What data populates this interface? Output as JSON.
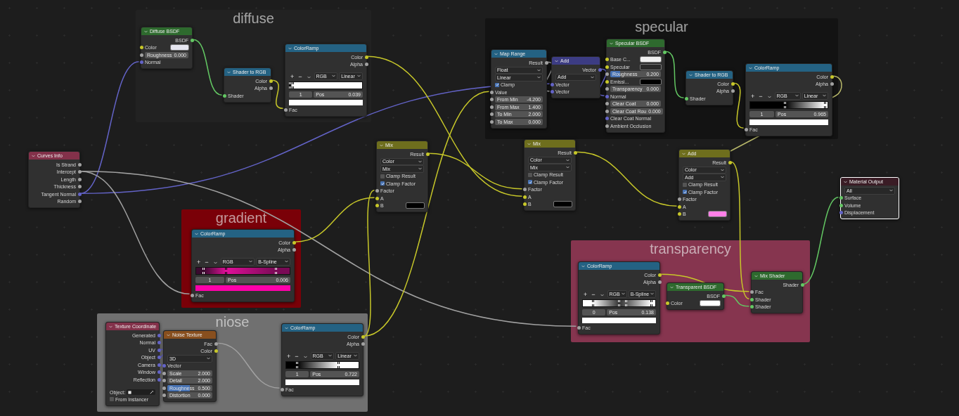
{
  "frames": [
    {
      "label": "diffuse",
      "color": "#222222"
    },
    {
      "label": "specular",
      "color": "#131313"
    },
    {
      "label": "gradient",
      "color": "#7a0008"
    },
    {
      "label": "niose",
      "color": "#707070"
    },
    {
      "label": "transparency",
      "color": "#86354f"
    }
  ],
  "nodes": [
    {
      "title": "Curves Info",
      "color": "#83314a",
      "selected": false,
      "rows": [
        {
          "kind": "output",
          "label": "Is Strand",
          "socket": {
            "color": "#a1a1a1"
          }
        },
        {
          "kind": "output",
          "label": "Intercept",
          "socket": {
            "color": "#a1a1a1"
          }
        },
        {
          "kind": "output",
          "label": "Length",
          "socket": {
            "color": "#a1a1a1"
          }
        },
        {
          "kind": "output",
          "label": "Thickness",
          "socket": {
            "color": "#a1a1a1"
          }
        },
        {
          "kind": "output",
          "label": "Tangent Normal",
          "socket": {
            "color": "#6363c7"
          }
        },
        {
          "kind": "output",
          "label": "Random",
          "socket": {
            "color": "#a1a1a1"
          }
        }
      ]
    },
    {
      "title": "Diffuse BSDF",
      "color": "#2e6a2e",
      "selected": false,
      "rows": [
        {
          "kind": "output",
          "label": "BSDF",
          "socket": {
            "color": "#63c763"
          }
        },
        {
          "kind": "swatch",
          "label": "Color",
          "socket": {
            "color": "#c7c729"
          },
          "color": "#e6e6f0"
        },
        {
          "kind": "value",
          "label": "Roughness",
          "value": "0.000",
          "socket": {
            "color": "#a1a1a1"
          }
        },
        {
          "kind": "input",
          "label": "Normal",
          "socket": {
            "color": "#6363c7"
          }
        }
      ]
    },
    {
      "title": "Shader to RGB",
      "color": "#246283",
      "selected": false,
      "rows": [
        {
          "kind": "output",
          "label": "Color",
          "socket": {
            "color": "#c7c729"
          }
        },
        {
          "kind": "output",
          "label": "Alpha",
          "socket": {
            "color": "#a1a1a1"
          }
        },
        {
          "kind": "input",
          "label": "Shader",
          "socket": {
            "color": "#63c763"
          }
        }
      ]
    },
    {
      "title": "ColorRamp",
      "color": "#246283",
      "selected": false,
      "rows": [
        {
          "kind": "output",
          "label": "Color",
          "socket": {
            "color": "#c7c729"
          }
        },
        {
          "kind": "output",
          "label": "Alpha",
          "socket": {
            "color": "#a1a1a1"
          }
        },
        {
          "kind": "ramp_tools",
          "add": "+",
          "remove": "−",
          "color_mode": "RGB",
          "interpolation": "Linear"
        },
        {
          "kind": "ramp",
          "stops": [
            {
              "color": "#000000",
              "level": 0.0
            },
            {
              "color": "#ffffff",
              "level": 0.039
            }
          ]
        },
        {
          "kind": "ramp_fields",
          "index": "1",
          "label": "Pos",
          "value": "0.039"
        },
        {
          "kind": "ramp_color",
          "color": "#ffffff"
        },
        {
          "kind": "input",
          "label": "Fac",
          "socket": {
            "color": "#a1a1a1"
          }
        }
      ]
    },
    {
      "title": "Map Range",
      "color": "#246283",
      "selected": false,
      "rows": [
        {
          "kind": "output",
          "label": "Result",
          "socket": {
            "color": "#a1a1a1"
          }
        },
        {
          "kind": "select",
          "value": "Float"
        },
        {
          "kind": "select",
          "value": "Linear"
        },
        {
          "kind": "check",
          "label": "Clamp",
          "checked": true
        },
        {
          "kind": "input",
          "label": "Value",
          "socket": {
            "color": "#a1a1a1"
          }
        },
        {
          "kind": "value",
          "label": "From Min",
          "value": "-4.200",
          "socket": {
            "color": "#a1a1a1"
          }
        },
        {
          "kind": "value",
          "label": "From Max",
          "value": "1.400",
          "socket": {
            "color": "#a1a1a1"
          }
        },
        {
          "kind": "value",
          "label": "To Min",
          "value": "2.000",
          "socket": {
            "color": "#a1a1a1"
          }
        },
        {
          "kind": "value",
          "label": "To Max",
          "value": "0.000",
          "socket": {
            "color": "#a1a1a1"
          }
        }
      ]
    },
    {
      "title": "Add",
      "color": "#3c3c83",
      "selected": false,
      "rows": [
        {
          "kind": "output",
          "label": "Vector",
          "socket": {
            "color": "#6363c7"
          }
        },
        {
          "kind": "select",
          "value": "Add"
        },
        {
          "kind": "input",
          "label": "Vector",
          "socket": {
            "color": "#6363c7"
          }
        },
        {
          "kind": "input",
          "label": "Vector",
          "socket": {
            "color": "#6363c7"
          }
        }
      ]
    },
    {
      "title": "Specular BSDF",
      "color": "#2e6a2e",
      "selected": false,
      "rows": [
        {
          "kind": "output",
          "label": "BSDF",
          "socket": {
            "color": "#63c763"
          }
        },
        {
          "kind": "swatch",
          "label": "Base C...",
          "socket": {
            "color": "#c7c729"
          },
          "color": "#f0f0f0"
        },
        {
          "kind": "swatch",
          "label": "Specular",
          "socket": {
            "color": "#c7c729"
          },
          "color": "#2a2a2a"
        },
        {
          "kind": "value",
          "label": "Roughness",
          "value": "0.200",
          "level": 0.2,
          "socket": {
            "color": "#a1a1a1"
          }
        },
        {
          "kind": "swatch",
          "label": "Emissi...",
          "socket": {
            "color": "#c7c729"
          },
          "color": "#000000"
        },
        {
          "kind": "value",
          "label": "Transparency",
          "value": "0.000",
          "socket": {
            "color": "#a1a1a1"
          }
        },
        {
          "kind": "input",
          "label": "Normal",
          "socket": {
            "color": "#6363c7"
          }
        },
        {
          "kind": "value",
          "label": "Clear Coat",
          "value": "0.000",
          "socket": {
            "color": "#a1a1a1"
          }
        },
        {
          "kind": "value",
          "label": "Clear Coat Rou",
          "value": "0.000",
          "socket": {
            "color": "#a1a1a1"
          }
        },
        {
          "kind": "input",
          "label": "Clear Coat Normal",
          "socket": {
            "color": "#6363c7"
          }
        },
        {
          "kind": "input",
          "label": "Ambient Occlusion",
          "socket": {
            "color": "#a1a1a1"
          }
        }
      ]
    },
    {
      "title": "Shader to RGB",
      "color": "#246283",
      "selected": false,
      "rows": [
        {
          "kind": "output",
          "label": "Color",
          "socket": {
            "color": "#c7c729"
          }
        },
        {
          "kind": "output",
          "label": "Alpha",
          "socket": {
            "color": "#a1a1a1"
          }
        },
        {
          "kind": "input",
          "label": "Shader",
          "socket": {
            "color": "#63c763"
          }
        }
      ]
    },
    {
      "title": "ColorRamp",
      "color": "#246283",
      "selected": false,
      "rows": [
        {
          "kind": "output",
          "label": "Color",
          "socket": {
            "color": "#c7c729"
          }
        },
        {
          "kind": "output",
          "label": "Alpha",
          "socket": {
            "color": "#a1a1a1"
          }
        },
        {
          "kind": "ramp_tools",
          "add": "+",
          "remove": "−",
          "color_mode": "RGB",
          "interpolation": "Linear"
        },
        {
          "kind": "ramp",
          "stops": [
            {
              "color": "#000000",
              "level": 0.45
            },
            {
              "color": "#ffffff",
              "level": 0.965
            }
          ]
        },
        {
          "kind": "ramp_fields",
          "index": "1",
          "label": "Pos",
          "value": "0.965"
        },
        {
          "kind": "ramp_color",
          "color": "#ffffff"
        },
        {
          "kind": "input",
          "label": "Fac",
          "socket": {
            "color": "#a1a1a1"
          }
        }
      ]
    },
    {
      "title": "Mix",
      "color": "#6e6e1d",
      "selected": false,
      "rows": [
        {
          "kind": "output",
          "label": "Result",
          "socket": {
            "color": "#c7c729"
          }
        },
        {
          "kind": "select",
          "value": "Color"
        },
        {
          "kind": "select",
          "value": "Mix"
        },
        {
          "kind": "check",
          "label": "Clamp Result",
          "checked": false
        },
        {
          "kind": "check",
          "label": "Clamp Factor",
          "checked": true
        },
        {
          "kind": "input",
          "label": "Factor",
          "socket": {
            "color": "#a1a1a1"
          }
        },
        {
          "kind": "input",
          "label": "A",
          "socket": {
            "color": "#c7c729"
          }
        },
        {
          "kind": "swatch",
          "label": "B",
          "socket": {
            "color": "#c7c729"
          },
          "color": "#000000"
        }
      ]
    },
    {
      "title": "Mix",
      "color": "#6e6e1d",
      "selected": false,
      "rows": [
        {
          "kind": "output",
          "label": "Result",
          "socket": {
            "color": "#c7c729"
          }
        },
        {
          "kind": "select",
          "value": "Color"
        },
        {
          "kind": "select",
          "value": "Mix"
        },
        {
          "kind": "check",
          "label": "Clamp Result",
          "checked": false
        },
        {
          "kind": "check",
          "label": "Clamp Factor",
          "checked": true
        },
        {
          "kind": "input",
          "label": "Factor",
          "socket": {
            "color": "#a1a1a1"
          }
        },
        {
          "kind": "input",
          "label": "A",
          "socket": {
            "color": "#c7c729"
          }
        },
        {
          "kind": "swatch",
          "label": "B",
          "socket": {
            "color": "#c7c729"
          },
          "color": "#000000"
        }
      ]
    },
    {
      "title": "Add",
      "color": "#6e6e1d",
      "selected": false,
      "rows": [
        {
          "kind": "output",
          "label": "Result",
          "socket": {
            "color": "#c7c729"
          }
        },
        {
          "kind": "select",
          "value": "Color"
        },
        {
          "kind": "select",
          "value": "Add"
        },
        {
          "kind": "check",
          "label": "Clamp Result",
          "checked": false
        },
        {
          "kind": "check",
          "label": "Clamp Factor",
          "checked": true
        },
        {
          "kind": "input",
          "label": "Factor",
          "socket": {
            "color": "#a1a1a1"
          }
        },
        {
          "kind": "input",
          "label": "A",
          "socket": {
            "color": "#c7c729"
          }
        },
        {
          "kind": "swatch",
          "label": "B",
          "socket": {
            "color": "#c7c729"
          },
          "color": "#ff80e8"
        }
      ]
    },
    {
      "title": "Material Output",
      "color": "#3a1c25",
      "selected": true,
      "rows": [
        {
          "kind": "select",
          "value": "All"
        },
        {
          "kind": "input",
          "label": "Surface",
          "socket": {
            "color": "#63c763"
          }
        },
        {
          "kind": "input",
          "label": "Volume",
          "socket": {
            "color": "#63c763"
          }
        },
        {
          "kind": "input",
          "label": "Displacement",
          "socket": {
            "color": "#6363c7"
          }
        }
      ]
    },
    {
      "title": "ColorRamp",
      "color": "#246283",
      "selected": false,
      "rows": [
        {
          "kind": "output",
          "label": "Color",
          "socket": {
            "color": "#c7c729"
          }
        },
        {
          "kind": "output",
          "label": "Alpha",
          "socket": {
            "color": "#a1a1a1"
          }
        },
        {
          "kind": "ramp_tools",
          "add": "+",
          "remove": "−",
          "color_mode": "RGB",
          "interpolation": "B-Spline"
        },
        {
          "kind": "ramp",
          "stops": [
            {
              "color": "#3a0a2e",
              "level": 0.08
            },
            {
              "color": "#e0109a",
              "level": 0.32
            },
            {
              "color": "#7a0a56",
              "level": 0.85
            }
          ]
        },
        {
          "kind": "ramp_fields",
          "index": "1",
          "label": "Pos",
          "value": "0.006"
        },
        {
          "kind": "ramp_color",
          "color": "#ff00aa"
        },
        {
          "kind": "input",
          "label": "Fac",
          "socket": {
            "color": "#a1a1a1"
          }
        }
      ]
    },
    {
      "title": "Texture Coordinate",
      "color": "#83314a",
      "selected": false,
      "rows": [
        {
          "kind": "output",
          "label": "Generated",
          "socket": {
            "color": "#6363c7"
          }
        },
        {
          "kind": "output",
          "label": "Normal",
          "socket": {
            "color": "#6363c7"
          }
        },
        {
          "kind": "output",
          "label": "UV",
          "socket": {
            "color": "#6363c7"
          }
        },
        {
          "kind": "output",
          "label": "Object",
          "socket": {
            "color": "#6363c7"
          }
        },
        {
          "kind": "output",
          "label": "Camera",
          "socket": {
            "color": "#6363c7"
          }
        },
        {
          "kind": "output",
          "label": "Window",
          "socket": {
            "color": "#6363c7"
          }
        },
        {
          "kind": "output",
          "label": "Reflection",
          "socket": {
            "color": "#6363c7"
          }
        },
        {
          "kind": "object",
          "label": "Object:"
        },
        {
          "kind": "check",
          "label": "From Instancer",
          "checked": false
        }
      ]
    },
    {
      "title": "Noise Texture",
      "color": "#884f1e",
      "selected": false,
      "rows": [
        {
          "kind": "output",
          "label": "Fac",
          "socket": {
            "color": "#a1a1a1"
          }
        },
        {
          "kind": "output",
          "label": "Color",
          "socket": {
            "color": "#c7c729"
          }
        },
        {
          "kind": "select",
          "value": "3D"
        },
        {
          "kind": "input",
          "label": "Vector",
          "socket": {
            "color": "#6363c7"
          }
        },
        {
          "kind": "value",
          "label": "Scale",
          "value": "2.000",
          "socket": {
            "color": "#a1a1a1"
          }
        },
        {
          "kind": "value",
          "label": "Detail",
          "value": "2.000",
          "socket": {
            "color": "#a1a1a1"
          }
        },
        {
          "kind": "value",
          "label": "Roughness",
          "value": "0.500",
          "level": 0.5,
          "socket": {
            "color": "#a1a1a1"
          }
        },
        {
          "kind": "value",
          "label": "Distortion",
          "value": "0.000",
          "socket": {
            "color": "#a1a1a1"
          }
        }
      ]
    },
    {
      "title": "ColorRamp",
      "color": "#246283",
      "selected": false,
      "rows": [
        {
          "kind": "output",
          "label": "Color",
          "socket": {
            "color": "#c7c729"
          }
        },
        {
          "kind": "output",
          "label": "Alpha",
          "socket": {
            "color": "#a1a1a1"
          }
        },
        {
          "kind": "ramp_tools",
          "add": "+",
          "remove": "−",
          "color_mode": "RGB",
          "interpolation": "Linear"
        },
        {
          "kind": "ramp",
          "stops": [
            {
              "color": "#000000",
              "level": 0.15
            },
            {
              "color": "#ffffff",
              "level": 0.722
            }
          ]
        },
        {
          "kind": "ramp_fields",
          "index": "1",
          "label": "Pos",
          "value": "0.722"
        },
        {
          "kind": "ramp_color",
          "color": "#ffffff"
        },
        {
          "kind": "input",
          "label": "Fac",
          "socket": {
            "color": "#a1a1a1"
          }
        }
      ]
    },
    {
      "title": "ColorRamp",
      "color": "#246283",
      "selected": false,
      "rows": [
        {
          "kind": "output",
          "label": "Color",
          "socket": {
            "color": "#c7c729"
          }
        },
        {
          "kind": "output",
          "label": "Alpha",
          "socket": {
            "color": "#a1a1a1"
          }
        },
        {
          "kind": "ramp_tools",
          "add": "+",
          "remove": "−",
          "color_mode": "RGB",
          "interpolation": "B-Spline"
        },
        {
          "kind": "ramp",
          "stops": [
            {
              "color": "#ffffff",
              "level": 0.138
            },
            {
              "color": "#333333",
              "level": 0.5
            },
            {
              "color": "#5a5a5a",
              "level": 0.6
            },
            {
              "color": "#ffffff",
              "level": 0.95
            }
          ]
        },
        {
          "kind": "ramp_fields",
          "index": "0",
          "label": "Pos",
          "value": "0.138"
        },
        {
          "kind": "ramp_color",
          "color": "#ffffff"
        },
        {
          "kind": "input",
          "label": "Fac",
          "socket": {
            "color": "#a1a1a1"
          }
        }
      ]
    },
    {
      "title": "Transparent BSDF",
      "color": "#2e6a2e",
      "selected": false,
      "rows": [
        {
          "kind": "output",
          "label": "BSDF",
          "socket": {
            "color": "#63c763"
          }
        },
        {
          "kind": "swatch",
          "label": "Color",
          "socket": {
            "color": "#c7c729"
          },
          "color": "#ffffff"
        }
      ]
    },
    {
      "title": "Mix Shader",
      "color": "#2e6a2e",
      "selected": false,
      "rows": [
        {
          "kind": "output",
          "label": "Shader",
          "socket": {
            "color": "#63c763"
          }
        },
        {
          "kind": "input",
          "label": "Fac",
          "socket": {
            "color": "#a1a1a1"
          }
        },
        {
          "kind": "input",
          "label": "Shader",
          "socket": {
            "color": "#63c763"
          }
        },
        {
          "kind": "input",
          "label": "Shader",
          "socket": {
            "color": "#63c763"
          }
        }
      ]
    }
  ]
}
